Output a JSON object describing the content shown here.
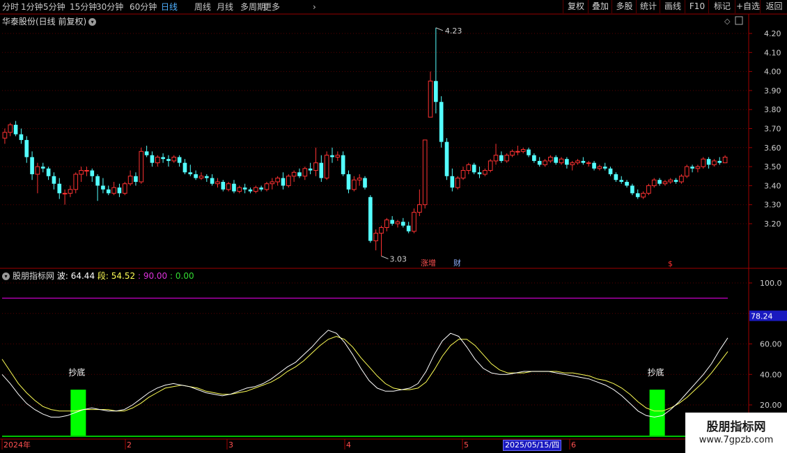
{
  "toolbar": {
    "periods": [
      "分时",
      "1分钟",
      "5分钟",
      "15分钟",
      "30分钟",
      "60分钟",
      "日线",
      "周线",
      "月线",
      "多周期",
      "更多"
    ],
    "active_period": "日线",
    "actions": [
      "复权",
      "叠加",
      "多股",
      "统计",
      "画线",
      "F10",
      "标记",
      "+自选",
      "返回"
    ]
  },
  "stock_title": "华泰股份(日线 前复权)",
  "price_axis": {
    "ticks": [
      "4.20",
      "4.10",
      "4.00",
      "3.90",
      "3.80",
      "3.70",
      "3.60",
      "3.50",
      "3.40",
      "3.30",
      "3.20"
    ]
  },
  "annotations": {
    "high": "4.23",
    "low": "3.03",
    "marker1": "涨增",
    "marker2": "财",
    "marker3": "$"
  },
  "indicator": {
    "name": "股朋指标网",
    "wave_label": "波:",
    "wave_value": "64.44",
    "seg_label": "段:",
    "seg_value": "54.52",
    "v3": ": 90.00",
    "v4": ": 0.00",
    "current_tag": "78.24",
    "axis_ticks": [
      "100.0",
      "80.00",
      "60.00",
      "40.00",
      "20.00"
    ],
    "signal_label": "抄底"
  },
  "time_axis": {
    "labels": [
      "2024年",
      "2",
      "3",
      "4",
      "5",
      "6"
    ],
    "current_date": "2025/05/15/四"
  },
  "watermark": {
    "line1": "股朋指标网",
    "line2": "www.7gpzb.com"
  },
  "colors": {
    "up": "#ff3232",
    "down": "#54ffff",
    "ma": "#ffffff",
    "wave": "#ffffff",
    "seg": "#ffff55",
    "limit": "#cc00cc",
    "signal": "#00ff00"
  },
  "chart_data": [
    {
      "type": "candlestick",
      "title": "华泰股份(日线 前复权)",
      "ylim": [
        3.0,
        4.3
      ],
      "series": [
        {
          "name": "price",
          "values": [
            [
              3.65,
              3.7,
              3.62,
              3.68
            ],
            [
              3.68,
              3.73,
              3.66,
              3.72
            ],
            [
              3.72,
              3.74,
              3.66,
              3.67
            ],
            [
              3.67,
              3.7,
              3.62,
              3.64
            ],
            [
              3.64,
              3.66,
              3.52,
              3.55
            ],
            [
              3.55,
              3.58,
              3.43,
              3.46
            ],
            [
              3.46,
              3.52,
              3.36,
              3.5
            ],
            [
              3.5,
              3.52,
              3.47,
              3.49
            ],
            [
              3.49,
              3.5,
              3.43,
              3.45
            ],
            [
              3.45,
              3.47,
              3.38,
              3.41
            ],
            [
              3.41,
              3.44,
              3.33,
              3.36
            ],
            [
              3.36,
              3.38,
              3.3,
              3.36
            ],
            [
              3.36,
              3.4,
              3.34,
              3.38
            ],
            [
              3.38,
              3.47,
              3.36,
              3.46
            ],
            [
              3.46,
              3.5,
              3.42,
              3.48
            ],
            [
              3.48,
              3.5,
              3.45,
              3.48
            ],
            [
              3.48,
              3.49,
              3.42,
              3.45
            ],
            [
              3.45,
              3.46,
              3.32,
              3.4
            ],
            [
              3.4,
              3.44,
              3.36,
              3.38
            ],
            [
              3.38,
              3.4,
              3.35,
              3.36
            ],
            [
              3.36,
              3.42,
              3.35,
              3.39
            ],
            [
              3.39,
              3.41,
              3.34,
              3.36
            ],
            [
              3.36,
              3.42,
              3.35,
              3.41
            ],
            [
              3.41,
              3.48,
              3.4,
              3.45
            ],
            [
              3.45,
              3.47,
              3.4,
              3.42
            ],
            [
              3.42,
              3.6,
              3.41,
              3.58
            ],
            [
              3.58,
              3.61,
              3.55,
              3.56
            ],
            [
              3.56,
              3.58,
              3.5,
              3.52
            ],
            [
              3.52,
              3.56,
              3.5,
              3.55
            ],
            [
              3.55,
              3.57,
              3.52,
              3.54
            ],
            [
              3.54,
              3.56,
              3.5,
              3.53
            ],
            [
              3.53,
              3.56,
              3.52,
              3.55
            ],
            [
              3.55,
              3.56,
              3.5,
              3.52
            ],
            [
              3.52,
              3.54,
              3.46,
              3.47
            ],
            [
              3.47,
              3.51,
              3.45,
              3.46
            ],
            [
              3.46,
              3.48,
              3.43,
              3.44
            ],
            [
              3.44,
              3.47,
              3.43,
              3.45
            ],
            [
              3.45,
              3.46,
              3.42,
              3.44
            ],
            [
              3.44,
              3.46,
              3.4,
              3.41
            ],
            [
              3.41,
              3.44,
              3.39,
              3.42
            ],
            [
              3.42,
              3.43,
              3.37,
              3.38
            ],
            [
              3.38,
              3.42,
              3.37,
              3.41
            ],
            [
              3.41,
              3.43,
              3.36,
              3.37
            ],
            [
              3.37,
              3.4,
              3.36,
              3.39
            ],
            [
              3.39,
              3.41,
              3.36,
              3.38
            ],
            [
              3.38,
              3.39,
              3.36,
              3.37
            ],
            [
              3.37,
              3.4,
              3.36,
              3.39
            ],
            [
              3.39,
              3.4,
              3.37,
              3.38
            ],
            [
              3.38,
              3.42,
              3.37,
              3.41
            ],
            [
              3.41,
              3.44,
              3.38,
              3.42
            ],
            [
              3.42,
              3.45,
              3.4,
              3.44
            ],
            [
              3.44,
              3.47,
              3.38,
              3.4
            ],
            [
              3.4,
              3.46,
              3.39,
              3.45
            ],
            [
              3.45,
              3.48,
              3.42,
              3.47
            ],
            [
              3.47,
              3.49,
              3.44,
              3.45
            ],
            [
              3.45,
              3.5,
              3.43,
              3.49
            ],
            [
              3.49,
              3.52,
              3.46,
              3.48
            ],
            [
              3.48,
              3.6,
              3.45,
              3.52
            ],
            [
              3.52,
              3.56,
              3.42,
              3.44
            ],
            [
              3.44,
              3.58,
              3.43,
              3.56
            ],
            [
              3.56,
              3.6,
              3.52,
              3.55
            ],
            [
              3.55,
              3.58,
              3.53,
              3.56
            ],
            [
              3.56,
              3.58,
              3.45,
              3.46
            ],
            [
              3.46,
              3.48,
              3.36,
              3.38
            ],
            [
              3.38,
              3.45,
              3.37,
              3.43
            ],
            [
              3.43,
              3.46,
              3.4,
              3.44
            ],
            [
              3.44,
              3.45,
              3.38,
              3.39
            ],
            [
              3.34,
              3.35,
              3.1,
              3.11
            ],
            [
              3.11,
              3.17,
              3.06,
              3.15
            ],
            [
              3.15,
              3.19,
              3.03,
              3.18
            ],
            [
              3.18,
              3.23,
              3.16,
              3.22
            ],
            [
              3.22,
              3.24,
              3.19,
              3.2
            ],
            [
              3.2,
              3.22,
              3.18,
              3.21
            ],
            [
              3.21,
              3.23,
              3.18,
              3.19
            ],
            [
              3.19,
              3.21,
              3.15,
              3.16
            ],
            [
              3.16,
              3.28,
              3.15,
              3.26
            ],
            [
              3.26,
              3.38,
              3.24,
              3.3
            ],
            [
              3.3,
              3.64,
              3.28,
              3.64
            ],
            [
              3.76,
              4.0,
              3.76,
              3.95
            ],
            [
              3.95,
              4.23,
              3.78,
              3.84
            ],
            [
              3.84,
              3.87,
              3.6,
              3.63
            ],
            [
              3.63,
              3.65,
              3.43,
              3.45
            ],
            [
              3.45,
              3.49,
              3.37,
              3.39
            ],
            [
              3.39,
              3.45,
              3.38,
              3.44
            ],
            [
              3.44,
              3.5,
              3.43,
              3.48
            ],
            [
              3.48,
              3.52,
              3.46,
              3.51
            ],
            [
              3.51,
              3.52,
              3.46,
              3.47
            ],
            [
              3.47,
              3.5,
              3.44,
              3.46
            ],
            [
              3.46,
              3.49,
              3.45,
              3.48
            ],
            [
              3.48,
              3.54,
              3.47,
              3.53
            ],
            [
              3.53,
              3.62,
              3.51,
              3.56
            ],
            [
              3.56,
              3.58,
              3.52,
              3.53
            ],
            [
              3.53,
              3.57,
              3.52,
              3.56
            ],
            [
              3.56,
              3.59,
              3.55,
              3.58
            ],
            [
              3.58,
              3.61,
              3.56,
              3.58
            ],
            [
              3.58,
              3.6,
              3.57,
              3.59
            ],
            [
              3.59,
              3.6,
              3.55,
              3.56
            ],
            [
              3.56,
              3.57,
              3.52,
              3.53
            ],
            [
              3.53,
              3.55,
              3.5,
              3.51
            ],
            [
              3.51,
              3.54,
              3.5,
              3.53
            ],
            [
              3.53,
              3.56,
              3.52,
              3.55
            ],
            [
              3.55,
              3.56,
              3.51,
              3.52
            ],
            [
              3.52,
              3.55,
              3.51,
              3.54
            ],
            [
              3.54,
              3.55,
              3.49,
              3.51
            ],
            [
              3.51,
              3.53,
              3.48,
              3.52
            ],
            [
              3.52,
              3.54,
              3.51,
              3.53
            ],
            [
              3.53,
              3.55,
              3.51,
              3.52
            ],
            [
              3.52,
              3.53,
              3.5,
              3.52
            ],
            [
              3.52,
              3.53,
              3.48,
              3.49
            ],
            [
              3.49,
              3.51,
              3.48,
              3.5
            ],
            [
              3.5,
              3.52,
              3.48,
              3.49
            ],
            [
              3.49,
              3.5,
              3.45,
              3.46
            ],
            [
              3.46,
              3.47,
              3.42,
              3.43
            ],
            [
              3.43,
              3.45,
              3.41,
              3.42
            ],
            [
              3.42,
              3.43,
              3.39,
              3.4
            ],
            [
              3.4,
              3.41,
              3.35,
              3.36
            ],
            [
              3.36,
              3.38,
              3.33,
              3.34
            ],
            [
              3.34,
              3.37,
              3.33,
              3.36
            ],
            [
              3.36,
              3.41,
              3.35,
              3.4
            ],
            [
              3.4,
              3.44,
              3.39,
              3.43
            ],
            [
              3.43,
              3.44,
              3.4,
              3.41
            ],
            [
              3.41,
              3.43,
              3.4,
              3.42
            ],
            [
              3.42,
              3.44,
              3.41,
              3.43
            ],
            [
              3.43,
              3.44,
              3.41,
              3.42
            ],
            [
              3.42,
              3.46,
              3.41,
              3.45
            ],
            [
              3.45,
              3.51,
              3.44,
              3.5
            ],
            [
              3.5,
              3.51,
              3.47,
              3.49
            ],
            [
              3.49,
              3.51,
              3.47,
              3.5
            ],
            [
              3.5,
              3.55,
              3.49,
              3.54
            ],
            [
              3.54,
              3.55,
              3.49,
              3.51
            ],
            [
              3.51,
              3.54,
              3.5,
              3.53
            ],
            [
              3.53,
              3.55,
              3.51,
              3.52
            ],
            [
              3.52,
              3.56,
              3.52,
              3.55
            ]
          ]
        }
      ]
    },
    {
      "type": "line",
      "title": "股朋指标网",
      "ylim": [
        0,
        110
      ],
      "series": [
        {
          "name": "波",
          "values": [
            40,
            34,
            27,
            21,
            17,
            14,
            12,
            12,
            13,
            15,
            17,
            18,
            17,
            16,
            16,
            17,
            20,
            24,
            28,
            31,
            33,
            34,
            33,
            32,
            30,
            28,
            27,
            26,
            27,
            29,
            31,
            32,
            34,
            37,
            41,
            45,
            48,
            53,
            58,
            64,
            69,
            67,
            61,
            53,
            44,
            36,
            31,
            29,
            29,
            30,
            31,
            34,
            42,
            53,
            62,
            67,
            65,
            58,
            50,
            44,
            41,
            40,
            40,
            41,
            42,
            42,
            42,
            42,
            41,
            40,
            39,
            38,
            37,
            35,
            33,
            30,
            26,
            21,
            16,
            13,
            12,
            13,
            17,
            22,
            28,
            34,
            40,
            47,
            56,
            64
          ]
        },
        {
          "name": "段",
          "values": [
            50,
            42,
            34,
            28,
            23,
            19,
            17,
            16,
            16,
            16,
            17,
            17,
            17,
            17,
            16,
            16,
            18,
            21,
            25,
            28,
            31,
            32,
            33,
            32,
            31,
            29,
            28,
            27,
            27,
            28,
            29,
            31,
            33,
            35,
            38,
            42,
            45,
            49,
            54,
            59,
            63,
            65,
            63,
            58,
            51,
            45,
            39,
            34,
            31,
            30,
            30,
            31,
            35,
            43,
            52,
            59,
            63,
            63,
            59,
            53,
            47,
            43,
            41,
            41,
            41,
            42,
            42,
            42,
            42,
            41,
            41,
            40,
            39,
            37,
            36,
            34,
            31,
            27,
            22,
            18,
            16,
            16,
            18,
            21,
            25,
            30,
            35,
            41,
            48,
            55
          ]
        }
      ],
      "level_lines": [
        90,
        0
      ],
      "signals": [
        {
          "label": "抄底",
          "index": 9
        },
        {
          "label": "抄底",
          "index": 80
        }
      ]
    }
  ]
}
